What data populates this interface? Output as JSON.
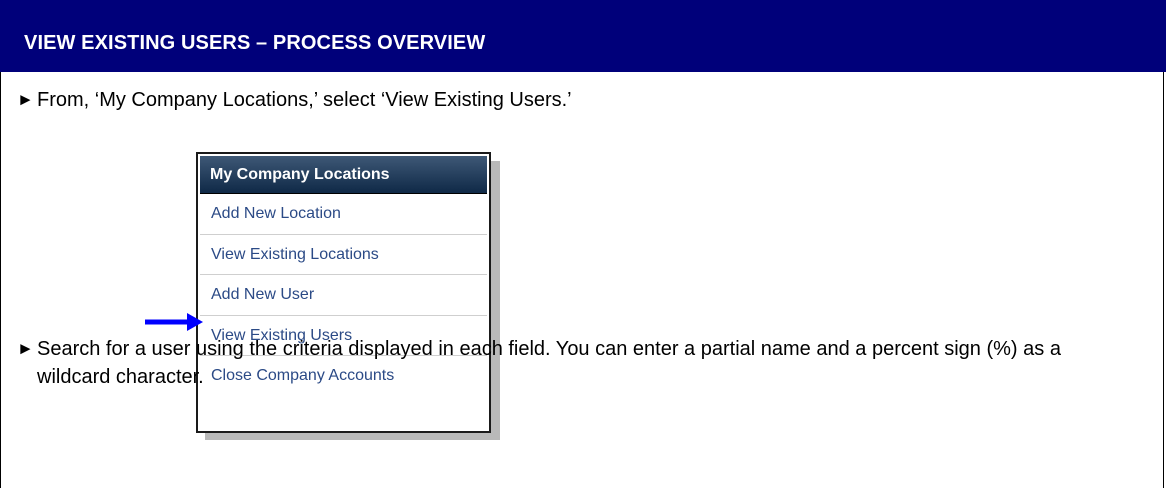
{
  "header": {
    "title": "VIEW EXISTING USERS – PROCESS OVERVIEW"
  },
  "bullets": [
    {
      "glyph": "►",
      "text": "From, ‘My Company Locations,’ select ‘View Existing Users.’"
    },
    {
      "glyph": "►",
      "text": "Search for a user using the criteria displayed in each field. You can enter a partial name and a percent sign (%) as a wildcard character."
    }
  ],
  "menu": {
    "title": "My Company Locations",
    "items": [
      {
        "label": "Add New Location"
      },
      {
        "label": "View Existing Locations"
      },
      {
        "label": "Add New User"
      },
      {
        "label": "View Existing Users"
      },
      {
        "label": "Close Company Accounts"
      }
    ]
  },
  "colors": {
    "header_bg": "#00007a",
    "menu_header_bg": "#1b3556",
    "menu_link": "#2b4a86",
    "arrow": "#0000ff"
  },
  "icons": {
    "pointer": "arrow-right-icon"
  }
}
